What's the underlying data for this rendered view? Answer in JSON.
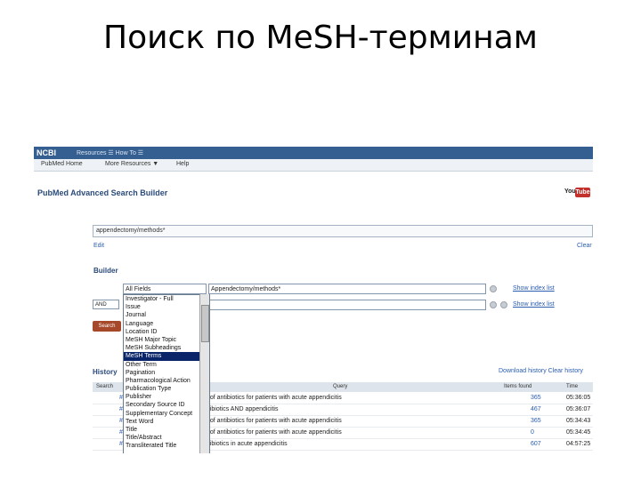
{
  "slide": {
    "title": "Поиск по MeSH-терминам"
  },
  "ncbi_bar": {
    "logo": "NCBI",
    "links": "Resources ☰  How To ☰"
  },
  "sub_nav": {
    "pubmed_home": "PubMed Home",
    "more_resources": "More Resources ▼",
    "help": "Help"
  },
  "page": {
    "heading": "PubMed Advanced Search Builder",
    "yt_you": "You",
    "yt_tube": "Tube"
  },
  "query": {
    "value": "appendectomy/methods*",
    "edit": "Edit",
    "clear": "Clear"
  },
  "builder": {
    "label": "Builder",
    "field_selected": "All Fields",
    "term1": "Appendectomy/methods*",
    "show_index": "Show index list",
    "operator": "AND",
    "search_button": "Search"
  },
  "dropdown_items": [
    {
      "label": "Investigator - Full",
      "selected": false
    },
    {
      "label": "Issue",
      "selected": false
    },
    {
      "label": "Journal",
      "selected": false
    },
    {
      "label": "Language",
      "selected": false
    },
    {
      "label": "Location ID",
      "selected": false
    },
    {
      "label": "MeSH Major Topic",
      "selected": false
    },
    {
      "label": "MeSH Subheadings",
      "selected": false
    },
    {
      "label": "MeSH Terms",
      "selected": true
    },
    {
      "label": "Other Term",
      "selected": false
    },
    {
      "label": "Pagination",
      "selected": false
    },
    {
      "label": "Pharmacological Action",
      "selected": false
    },
    {
      "label": "Publication Type",
      "selected": false
    },
    {
      "label": "Publisher",
      "selected": false
    },
    {
      "label": "Secondary Source ID",
      "selected": false
    },
    {
      "label": "Supplementary Concept",
      "selected": false
    },
    {
      "label": "Text Word",
      "selected": false
    },
    {
      "label": "Title",
      "selected": false
    },
    {
      "label": "Title/Abstract",
      "selected": false
    },
    {
      "label": "Transliterated Title",
      "selected": false
    }
  ],
  "history": {
    "label": "History",
    "download": "Download history  Clear history",
    "headers": {
      "search": "Search",
      "query": "Query",
      "items_found": "Items found",
      "time": "Time"
    },
    "rows": [
      {
        "num": "#7",
        "query": "e of antibiotics for patients with acute appendicitis",
        "items": "365",
        "time": "05:36:05"
      },
      {
        "num": "#6",
        "query": "ntibiotics AND appendicitis",
        "items": "467",
        "time": "05:36:07"
      },
      {
        "num": "#5",
        "query": "e of antibiotics for patients with acute appendicitis",
        "items": "365",
        "time": "05:34:43"
      },
      {
        "num": "#4",
        "query": "e of antibiotics for patients with acute appendicitis",
        "items": "0",
        "time": "05:34:45"
      },
      {
        "num": "#3",
        "query": "ntibiotics in acute appendicitis",
        "items": "607",
        "time": "04:57:25"
      }
    ]
  }
}
